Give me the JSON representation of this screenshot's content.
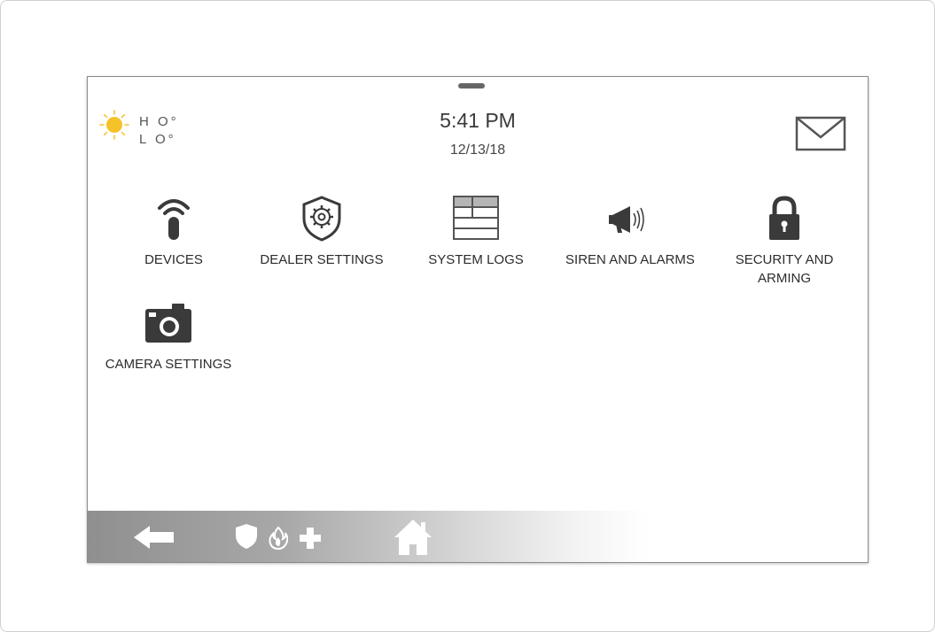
{
  "weather": {
    "icon": "sun-icon",
    "high_label": "H O°",
    "low_label": "L O°",
    "sun_color": "#F5C22A"
  },
  "clock": {
    "time": "5:41 PM",
    "date": "12/13/18"
  },
  "header": {
    "messages_icon": "envelope-icon"
  },
  "apps": [
    {
      "label": "DEVICES",
      "icon": "wifi-device-icon"
    },
    {
      "label": "DEALER SETTINGS",
      "icon": "shield-gear-icon"
    },
    {
      "label": "SYSTEM LOGS",
      "icon": "table-log-icon"
    },
    {
      "label": "SIREN AND ALARMS",
      "icon": "megaphone-icon"
    },
    {
      "label": "SECURITY AND ARMING",
      "icon": "padlock-icon"
    },
    {
      "label": "CAMERA SETTINGS",
      "icon": "camera-icon"
    }
  ],
  "bottom_bar": {
    "back_icon": "back-arrow-icon",
    "emergency_icons": [
      "shield-icon",
      "fire-icon",
      "medical-cross-icon"
    ],
    "home_icon": "home-icon"
  }
}
